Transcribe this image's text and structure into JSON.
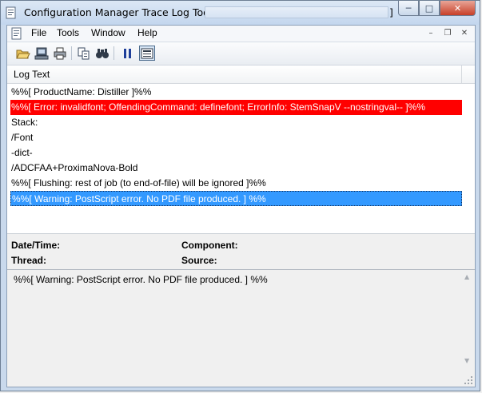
{
  "window": {
    "title": "Configuration Manager Trace Log Tool - [",
    "title_suffix": "]",
    "min_symbol": "─",
    "max_symbol": "□",
    "close_symbol": "✕"
  },
  "menu": {
    "items": [
      "File",
      "Tools",
      "Window",
      "Help"
    ],
    "mdi_min": "–",
    "mdi_restore": "❐",
    "mdi_close": "✕"
  },
  "toolbar": {
    "tools": [
      "open-icon",
      "save-icon",
      "print-icon",
      "copy-icon",
      "find-icon",
      "pause-icon",
      "highlight-icon"
    ]
  },
  "log": {
    "column_header": "Log Text",
    "rows": [
      {
        "text": "%%[ ProductName: Distiller ]%%",
        "state": "normal"
      },
      {
        "text": "%%[ Error: invalidfont; OffendingCommand: definefont; ErrorInfo: StemSnapV --nostringval-- ]%%",
        "state": "error"
      },
      {
        "text": "Stack:",
        "state": "normal"
      },
      {
        "text": "/Font",
        "state": "normal"
      },
      {
        "text": "-dict-",
        "state": "normal"
      },
      {
        "text": "/ADCFAA+ProximaNova-Bold",
        "state": "normal"
      },
      {
        "text": "%%[ Flushing: rest of job (to end-of-file) will be ignored ]%%",
        "state": "normal"
      },
      {
        "text": "%%[ Warning: PostScript error. No PDF file produced. ] %%",
        "state": "selected"
      }
    ]
  },
  "details": {
    "datetime_label": "Date/Time:",
    "component_label": "Component:",
    "thread_label": "Thread:",
    "source_label": "Source:"
  },
  "message": {
    "text": "%%[ Warning: PostScript error. No PDF file produced. ] %%"
  },
  "colors": {
    "error_row": "#ff0000",
    "selected_row": "#3399ff",
    "title_bar": "#c9d9ec"
  }
}
